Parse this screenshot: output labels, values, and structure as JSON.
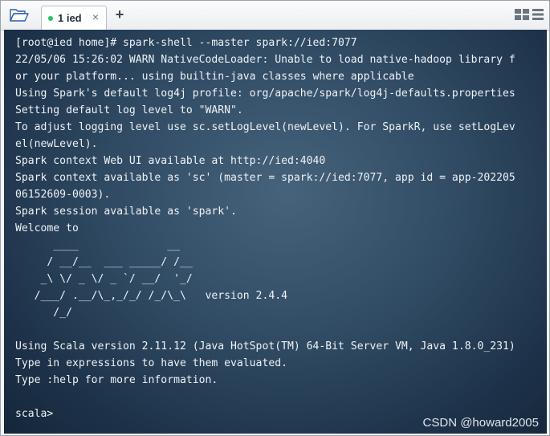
{
  "tab": {
    "label": "1 ied",
    "close_glyph": "×"
  },
  "toolbar": {
    "add_glyph": "+"
  },
  "icons": {
    "open": "folder-open-icon",
    "status": "connected-dot-icon",
    "close": "close-icon",
    "add": "plus-icon",
    "layout": "grid-layout-icon",
    "menu": "list-menu-icon"
  },
  "colors": {
    "terminal_bg": "#2f4a62",
    "terminal_text": "#eef2f6",
    "status_dot": "#22c55e"
  },
  "terminal": {
    "lines": [
      "[root@ied home]# spark-shell --master spark://ied:7077",
      "22/05/06 15:26:02 WARN NativeCodeLoader: Unable to load native-hadoop library f",
      "or your platform... using builtin-java classes where applicable",
      "Using Spark's default log4j profile: org/apache/spark/log4j-defaults.properties",
      "Setting default log level to \"WARN\".",
      "To adjust logging level use sc.setLogLevel(newLevel). For SparkR, use setLogLev",
      "el(newLevel).",
      "Spark context Web UI available at http://ied:4040",
      "Spark context available as 'sc' (master = spark://ied:7077, app id = app-202205",
      "06152609-0003).",
      "Spark session available as 'spark'.",
      "Welcome to",
      "      ____              __",
      "     / __/__  ___ _____/ /__",
      "    _\\ \\/ _ \\/ _ `/ __/  '_/",
      "   /___/ .__/\\_,_/_/ /_/\\_\\   version 2.4.4",
      "      /_/",
      "",
      "Using Scala version 2.11.12 (Java HotSpot(TM) 64-Bit Server VM, Java 1.8.0_231)",
      "Type in expressions to have them evaluated.",
      "Type :help for more information.",
      "",
      "scala>"
    ]
  },
  "watermark": "CSDN @howard2005"
}
